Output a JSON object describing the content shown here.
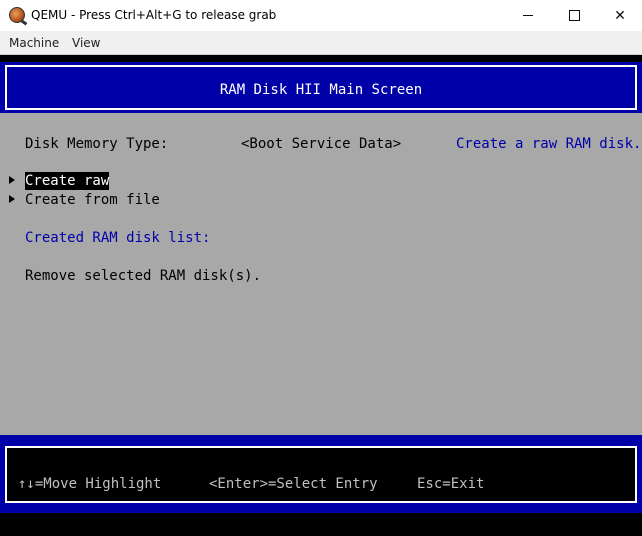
{
  "window": {
    "title": "QEMU - Press Ctrl+Alt+G to release grab",
    "controls": {
      "minimize": "minimize",
      "maximize": "maximize",
      "close": "✕"
    }
  },
  "menubar": {
    "items": [
      "Machine",
      "View"
    ]
  },
  "screen": {
    "header": "RAM Disk HII Main Screen",
    "disk_memory_type": {
      "label": "Disk Memory Type:",
      "value": "<Boot Service Data>",
      "help": "Create a raw RAM disk."
    },
    "options": [
      "Create raw",
      "Create from file"
    ],
    "selected_option": "Create raw",
    "list_label": "Created RAM disk list:",
    "remove_label": "Remove selected RAM disk(s).",
    "footer": {
      "move": "↑↓=Move Highlight",
      "select": "<Enter>=Select Entry",
      "exit": "Esc=Exit"
    }
  },
  "colors": {
    "header_blue": "#0000a8",
    "body_gray": "#a8a8a8",
    "help_text": "#0000a8",
    "highlight_bg": "#000000",
    "highlight_fg": "#ffffff"
  }
}
